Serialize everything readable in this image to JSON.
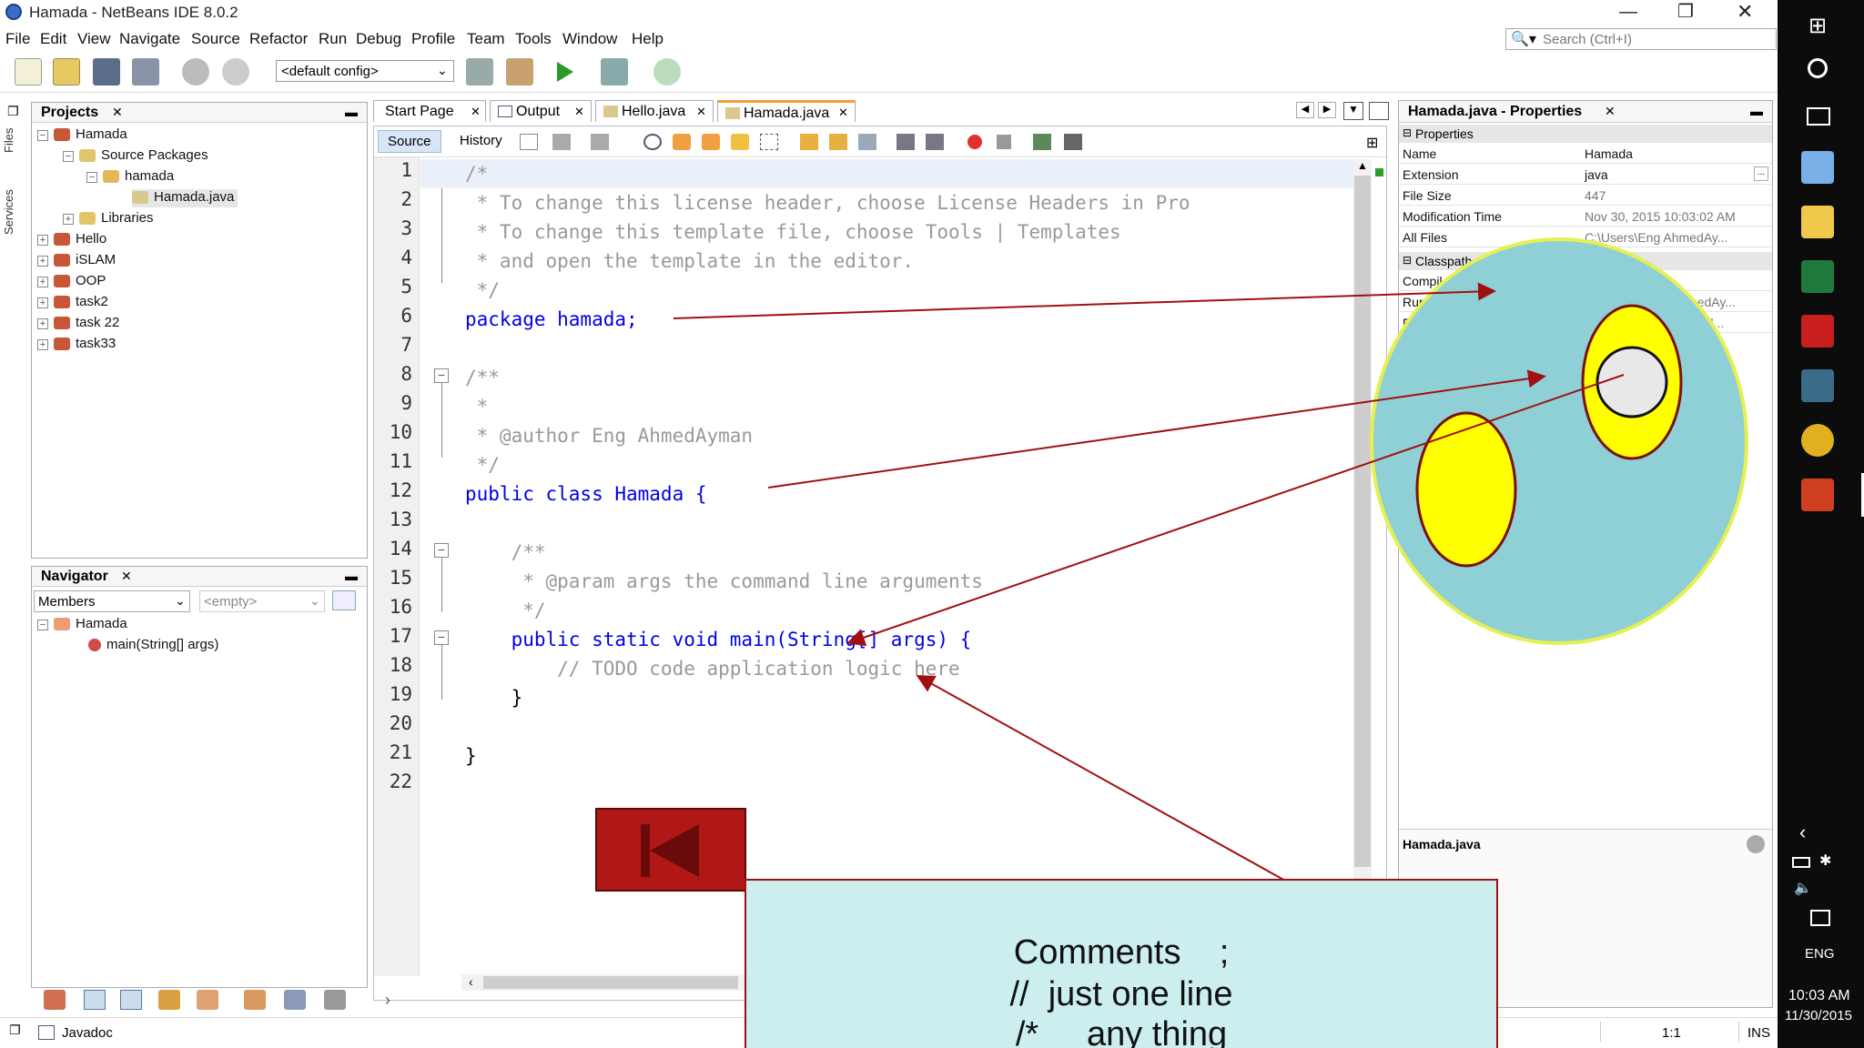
{
  "window": {
    "title": "Hamada - NetBeans IDE 8.0.2"
  },
  "menu": [
    "File",
    "Edit",
    "View",
    "Navigate",
    "Source",
    "Refactor",
    "Run",
    "Debug",
    "Profile",
    "Team",
    "Tools",
    "Window",
    "Help"
  ],
  "search": {
    "placeholder": "Search (Ctrl+I)"
  },
  "toolbar": {
    "config": "<default config>"
  },
  "side_strip": {
    "files": "Files",
    "services": "Services"
  },
  "projects": {
    "title": "Projects",
    "tree": [
      "Hamada",
      "Source Packages",
      "hamada",
      "Hamada.java",
      "Libraries",
      "Hello",
      "iSLAM",
      "OOP",
      "task2",
      "task 22",
      "task33"
    ]
  },
  "navigator": {
    "title": "Navigator",
    "filter": "Members",
    "filter2": "<empty>",
    "root": "Hamada",
    "member": "main(String[] args)"
  },
  "editor": {
    "tabs": [
      "Start Page",
      "Output",
      "Hello.java",
      "Hamada.java"
    ],
    "modes": {
      "source": "Source",
      "history": "History"
    },
    "line_numbers": [
      "1",
      "2",
      "3",
      "4",
      "5",
      "6",
      "7",
      "8",
      "9",
      "10",
      "11",
      "12",
      "13",
      "14",
      "15",
      "16",
      "17",
      "18",
      "19",
      "20",
      "21",
      "22"
    ],
    "lines": [
      "/*",
      " * To change this license header, choose License Headers in Pro",
      " * To change this template file, choose Tools | Templates",
      " * and open the template in the editor.",
      " */",
      "package hamada;",
      "",
      "/**",
      " *",
      " * @author Eng AhmedAyman",
      " */",
      "public class Hamada {",
      "",
      "    /**",
      "     * @param args the command line arguments",
      "     */",
      "    public static void main(String[] args) {",
      "        // TODO code application logic here",
      "    }",
      "",
      "}",
      ""
    ]
  },
  "properties": {
    "title": "Hamada.java - Properties",
    "section": "Properties",
    "section2": "Classpath",
    "rows": [
      {
        "key": "Name",
        "value": "Hamada"
      },
      {
        "key": "Extension",
        "value": "java"
      },
      {
        "key": "File Size",
        "value": "447"
      },
      {
        "key": "Modification Time",
        "value": "Nov 30, 2015 10:03:02 AM"
      },
      {
        "key": "All Files",
        "value": "C:\\Users\\Eng AhmedAy..."
      }
    ],
    "classpath_rows": [
      "Compil",
      "Run",
      "F"
    ],
    "classpath_vals": [
      "",
      "medAy...",
      "va\\id..."
    ],
    "footer": "Hamada.java"
  },
  "statusbar": {
    "javadoc": "Javadoc",
    "position": "1:1",
    "mode": "INS"
  },
  "taskbar": {
    "lang": "ENG",
    "time": "10:03 AM",
    "date": "11/30/2015"
  },
  "overlay": {
    "line1": "Comments    ;",
    "line2": "//  just one line",
    "line3": "/*     any thing"
  },
  "colors": {
    "circle": "#8fcfd6",
    "ellipse": "#ffff00",
    "arrow": "#a01010",
    "back_button": "#b01818",
    "note_box": "#cdeeee"
  }
}
